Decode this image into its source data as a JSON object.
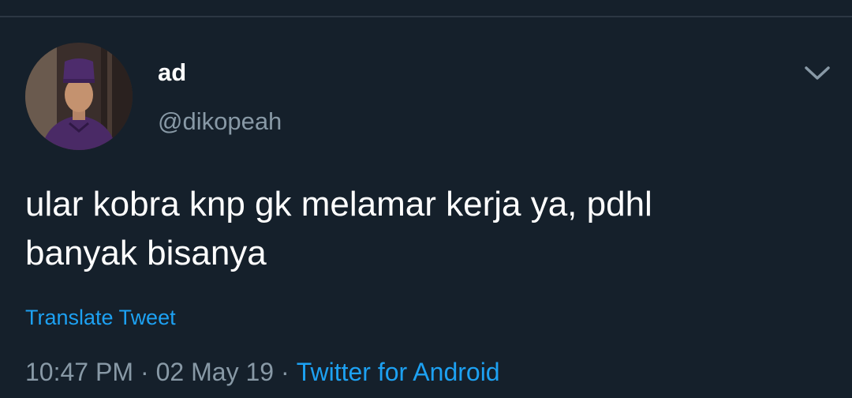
{
  "tweet": {
    "display_name": "ad",
    "handle": "@dikopeah",
    "text_line1": "ular kobra knp gk melamar kerja ya, pdhl",
    "text_line2": "banyak bisanya",
    "translate_label": "Translate Tweet",
    "time": "10:47 PM",
    "date": "02 May 19",
    "separator": "·",
    "source": "Twitter for Android"
  },
  "icons": {
    "more": "chevron-down-icon",
    "avatar": "user-avatar-photo"
  },
  "colors": {
    "background": "#15202b",
    "primary_text": "#ffffff",
    "secondary_text": "#8899a6",
    "link": "#1da1f2",
    "divider": "#2c3743"
  }
}
